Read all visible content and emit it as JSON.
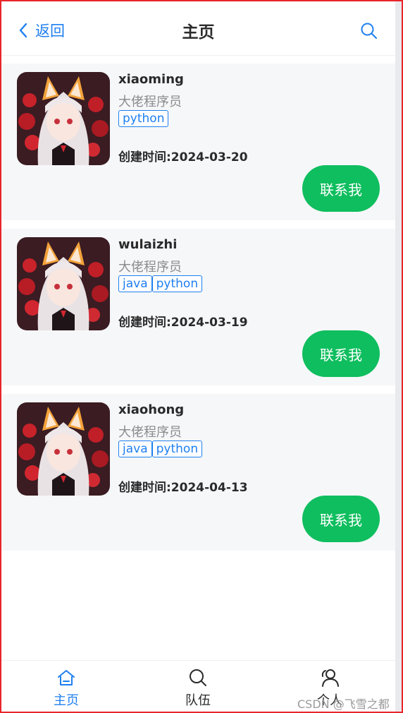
{
  "navbar": {
    "back_label": "返回",
    "title": "主页",
    "search_icon": "search-icon"
  },
  "users": [
    {
      "username": "xiaoming",
      "profile": "大佬程序员",
      "tags": [
        "python"
      ],
      "created": "创建时间:2024-03-20",
      "contact_label": "联系我"
    },
    {
      "username": "wulaizhi",
      "profile": "大佬程序员",
      "tags": [
        "java",
        "python"
      ],
      "created": "创建时间:2024-03-19",
      "contact_label": "联系我"
    },
    {
      "username": "xiaohong",
      "profile": "大佬程序员",
      "tags": [
        "java",
        "python"
      ],
      "created": "创建时间:2024-04-13",
      "contact_label": "联系我"
    }
  ],
  "tabbar": {
    "items": [
      {
        "label": "主页",
        "icon": "home-icon",
        "active": true
      },
      {
        "label": "队伍",
        "icon": "search-icon",
        "active": false
      },
      {
        "label": "个人",
        "icon": "friends-icon",
        "active": false
      }
    ]
  },
  "watermark": "CSDN @飞雪之都",
  "colors": {
    "primary": "#1e7ff0",
    "success": "#0fbe5e",
    "card_bg": "#f6f7f9",
    "frame_border": "#e8262a"
  }
}
